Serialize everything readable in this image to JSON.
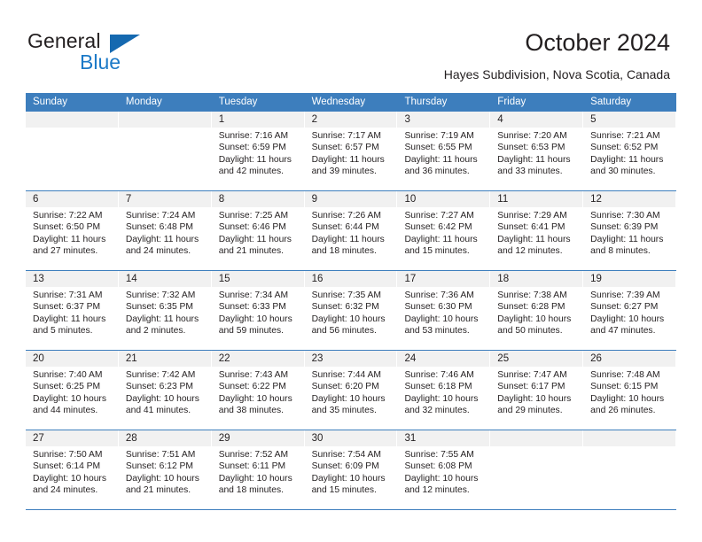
{
  "brand": {
    "name_part1": "General",
    "name_part2": "Blue",
    "triangle_color": "#1569b0",
    "blue_color": "#1b79c7"
  },
  "header": {
    "title": "October 2024",
    "subtitle": "Hayes Subdivision, Nova Scotia, Canada"
  },
  "theme": {
    "header_blue": "#3d7ebd",
    "day_band_gray": "#f1f1f1",
    "text_color": "#231f20"
  },
  "weekdays": [
    "Sunday",
    "Monday",
    "Tuesday",
    "Wednesday",
    "Thursday",
    "Friday",
    "Saturday"
  ],
  "weeks": [
    [
      {
        "day": "",
        "sunrise": "",
        "sunset": "",
        "daylight_line1": "",
        "daylight_line2": ""
      },
      {
        "day": "",
        "sunrise": "",
        "sunset": "",
        "daylight_line1": "",
        "daylight_line2": ""
      },
      {
        "day": "1",
        "sunrise": "Sunrise: 7:16 AM",
        "sunset": "Sunset: 6:59 PM",
        "daylight_line1": "Daylight: 11 hours",
        "daylight_line2": "and 42 minutes."
      },
      {
        "day": "2",
        "sunrise": "Sunrise: 7:17 AM",
        "sunset": "Sunset: 6:57 PM",
        "daylight_line1": "Daylight: 11 hours",
        "daylight_line2": "and 39 minutes."
      },
      {
        "day": "3",
        "sunrise": "Sunrise: 7:19 AM",
        "sunset": "Sunset: 6:55 PM",
        "daylight_line1": "Daylight: 11 hours",
        "daylight_line2": "and 36 minutes."
      },
      {
        "day": "4",
        "sunrise": "Sunrise: 7:20 AM",
        "sunset": "Sunset: 6:53 PM",
        "daylight_line1": "Daylight: 11 hours",
        "daylight_line2": "and 33 minutes."
      },
      {
        "day": "5",
        "sunrise": "Sunrise: 7:21 AM",
        "sunset": "Sunset: 6:52 PM",
        "daylight_line1": "Daylight: 11 hours",
        "daylight_line2": "and 30 minutes."
      }
    ],
    [
      {
        "day": "6",
        "sunrise": "Sunrise: 7:22 AM",
        "sunset": "Sunset: 6:50 PM",
        "daylight_line1": "Daylight: 11 hours",
        "daylight_line2": "and 27 minutes."
      },
      {
        "day": "7",
        "sunrise": "Sunrise: 7:24 AM",
        "sunset": "Sunset: 6:48 PM",
        "daylight_line1": "Daylight: 11 hours",
        "daylight_line2": "and 24 minutes."
      },
      {
        "day": "8",
        "sunrise": "Sunrise: 7:25 AM",
        "sunset": "Sunset: 6:46 PM",
        "daylight_line1": "Daylight: 11 hours",
        "daylight_line2": "and 21 minutes."
      },
      {
        "day": "9",
        "sunrise": "Sunrise: 7:26 AM",
        "sunset": "Sunset: 6:44 PM",
        "daylight_line1": "Daylight: 11 hours",
        "daylight_line2": "and 18 minutes."
      },
      {
        "day": "10",
        "sunrise": "Sunrise: 7:27 AM",
        "sunset": "Sunset: 6:42 PM",
        "daylight_line1": "Daylight: 11 hours",
        "daylight_line2": "and 15 minutes."
      },
      {
        "day": "11",
        "sunrise": "Sunrise: 7:29 AM",
        "sunset": "Sunset: 6:41 PM",
        "daylight_line1": "Daylight: 11 hours",
        "daylight_line2": "and 12 minutes."
      },
      {
        "day": "12",
        "sunrise": "Sunrise: 7:30 AM",
        "sunset": "Sunset: 6:39 PM",
        "daylight_line1": "Daylight: 11 hours",
        "daylight_line2": "and 8 minutes."
      }
    ],
    [
      {
        "day": "13",
        "sunrise": "Sunrise: 7:31 AM",
        "sunset": "Sunset: 6:37 PM",
        "daylight_line1": "Daylight: 11 hours",
        "daylight_line2": "and 5 minutes."
      },
      {
        "day": "14",
        "sunrise": "Sunrise: 7:32 AM",
        "sunset": "Sunset: 6:35 PM",
        "daylight_line1": "Daylight: 11 hours",
        "daylight_line2": "and 2 minutes."
      },
      {
        "day": "15",
        "sunrise": "Sunrise: 7:34 AM",
        "sunset": "Sunset: 6:33 PM",
        "daylight_line1": "Daylight: 10 hours",
        "daylight_line2": "and 59 minutes."
      },
      {
        "day": "16",
        "sunrise": "Sunrise: 7:35 AM",
        "sunset": "Sunset: 6:32 PM",
        "daylight_line1": "Daylight: 10 hours",
        "daylight_line2": "and 56 minutes."
      },
      {
        "day": "17",
        "sunrise": "Sunrise: 7:36 AM",
        "sunset": "Sunset: 6:30 PM",
        "daylight_line1": "Daylight: 10 hours",
        "daylight_line2": "and 53 minutes."
      },
      {
        "day": "18",
        "sunrise": "Sunrise: 7:38 AM",
        "sunset": "Sunset: 6:28 PM",
        "daylight_line1": "Daylight: 10 hours",
        "daylight_line2": "and 50 minutes."
      },
      {
        "day": "19",
        "sunrise": "Sunrise: 7:39 AM",
        "sunset": "Sunset: 6:27 PM",
        "daylight_line1": "Daylight: 10 hours",
        "daylight_line2": "and 47 minutes."
      }
    ],
    [
      {
        "day": "20",
        "sunrise": "Sunrise: 7:40 AM",
        "sunset": "Sunset: 6:25 PM",
        "daylight_line1": "Daylight: 10 hours",
        "daylight_line2": "and 44 minutes."
      },
      {
        "day": "21",
        "sunrise": "Sunrise: 7:42 AM",
        "sunset": "Sunset: 6:23 PM",
        "daylight_line1": "Daylight: 10 hours",
        "daylight_line2": "and 41 minutes."
      },
      {
        "day": "22",
        "sunrise": "Sunrise: 7:43 AM",
        "sunset": "Sunset: 6:22 PM",
        "daylight_line1": "Daylight: 10 hours",
        "daylight_line2": "and 38 minutes."
      },
      {
        "day": "23",
        "sunrise": "Sunrise: 7:44 AM",
        "sunset": "Sunset: 6:20 PM",
        "daylight_line1": "Daylight: 10 hours",
        "daylight_line2": "and 35 minutes."
      },
      {
        "day": "24",
        "sunrise": "Sunrise: 7:46 AM",
        "sunset": "Sunset: 6:18 PM",
        "daylight_line1": "Daylight: 10 hours",
        "daylight_line2": "and 32 minutes."
      },
      {
        "day": "25",
        "sunrise": "Sunrise: 7:47 AM",
        "sunset": "Sunset: 6:17 PM",
        "daylight_line1": "Daylight: 10 hours",
        "daylight_line2": "and 29 minutes."
      },
      {
        "day": "26",
        "sunrise": "Sunrise: 7:48 AM",
        "sunset": "Sunset: 6:15 PM",
        "daylight_line1": "Daylight: 10 hours",
        "daylight_line2": "and 26 minutes."
      }
    ],
    [
      {
        "day": "27",
        "sunrise": "Sunrise: 7:50 AM",
        "sunset": "Sunset: 6:14 PM",
        "daylight_line1": "Daylight: 10 hours",
        "daylight_line2": "and 24 minutes."
      },
      {
        "day": "28",
        "sunrise": "Sunrise: 7:51 AM",
        "sunset": "Sunset: 6:12 PM",
        "daylight_line1": "Daylight: 10 hours",
        "daylight_line2": "and 21 minutes."
      },
      {
        "day": "29",
        "sunrise": "Sunrise: 7:52 AM",
        "sunset": "Sunset: 6:11 PM",
        "daylight_line1": "Daylight: 10 hours",
        "daylight_line2": "and 18 minutes."
      },
      {
        "day": "30",
        "sunrise": "Sunrise: 7:54 AM",
        "sunset": "Sunset: 6:09 PM",
        "daylight_line1": "Daylight: 10 hours",
        "daylight_line2": "and 15 minutes."
      },
      {
        "day": "31",
        "sunrise": "Sunrise: 7:55 AM",
        "sunset": "Sunset: 6:08 PM",
        "daylight_line1": "Daylight: 10 hours",
        "daylight_line2": "and 12 minutes."
      },
      {
        "day": "",
        "sunrise": "",
        "sunset": "",
        "daylight_line1": "",
        "daylight_line2": ""
      },
      {
        "day": "",
        "sunrise": "",
        "sunset": "",
        "daylight_line1": "",
        "daylight_line2": ""
      }
    ]
  ]
}
